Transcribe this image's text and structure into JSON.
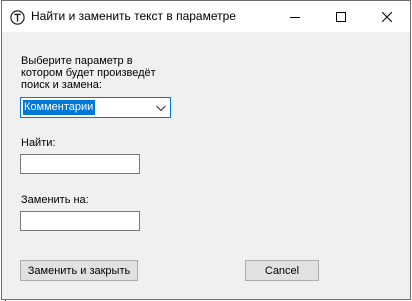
{
  "window": {
    "title": "Найти и заменить текст в параметре"
  },
  "form": {
    "prompt_label": "Выберите параметр в\nкотором будет произведёт\nпоиск и замена:",
    "parameter_select": {
      "selected": "Комментарии"
    },
    "find_label": "Найти:",
    "find_value": "",
    "replace_label": "Заменить на:",
    "replace_value": ""
  },
  "buttons": {
    "replace_close": "Заменить и закрыть",
    "cancel": "Cancel"
  },
  "colors": {
    "accent": "#0078d7",
    "window_bg": "#f0f0f0",
    "button_bg": "#e1e1e1"
  }
}
